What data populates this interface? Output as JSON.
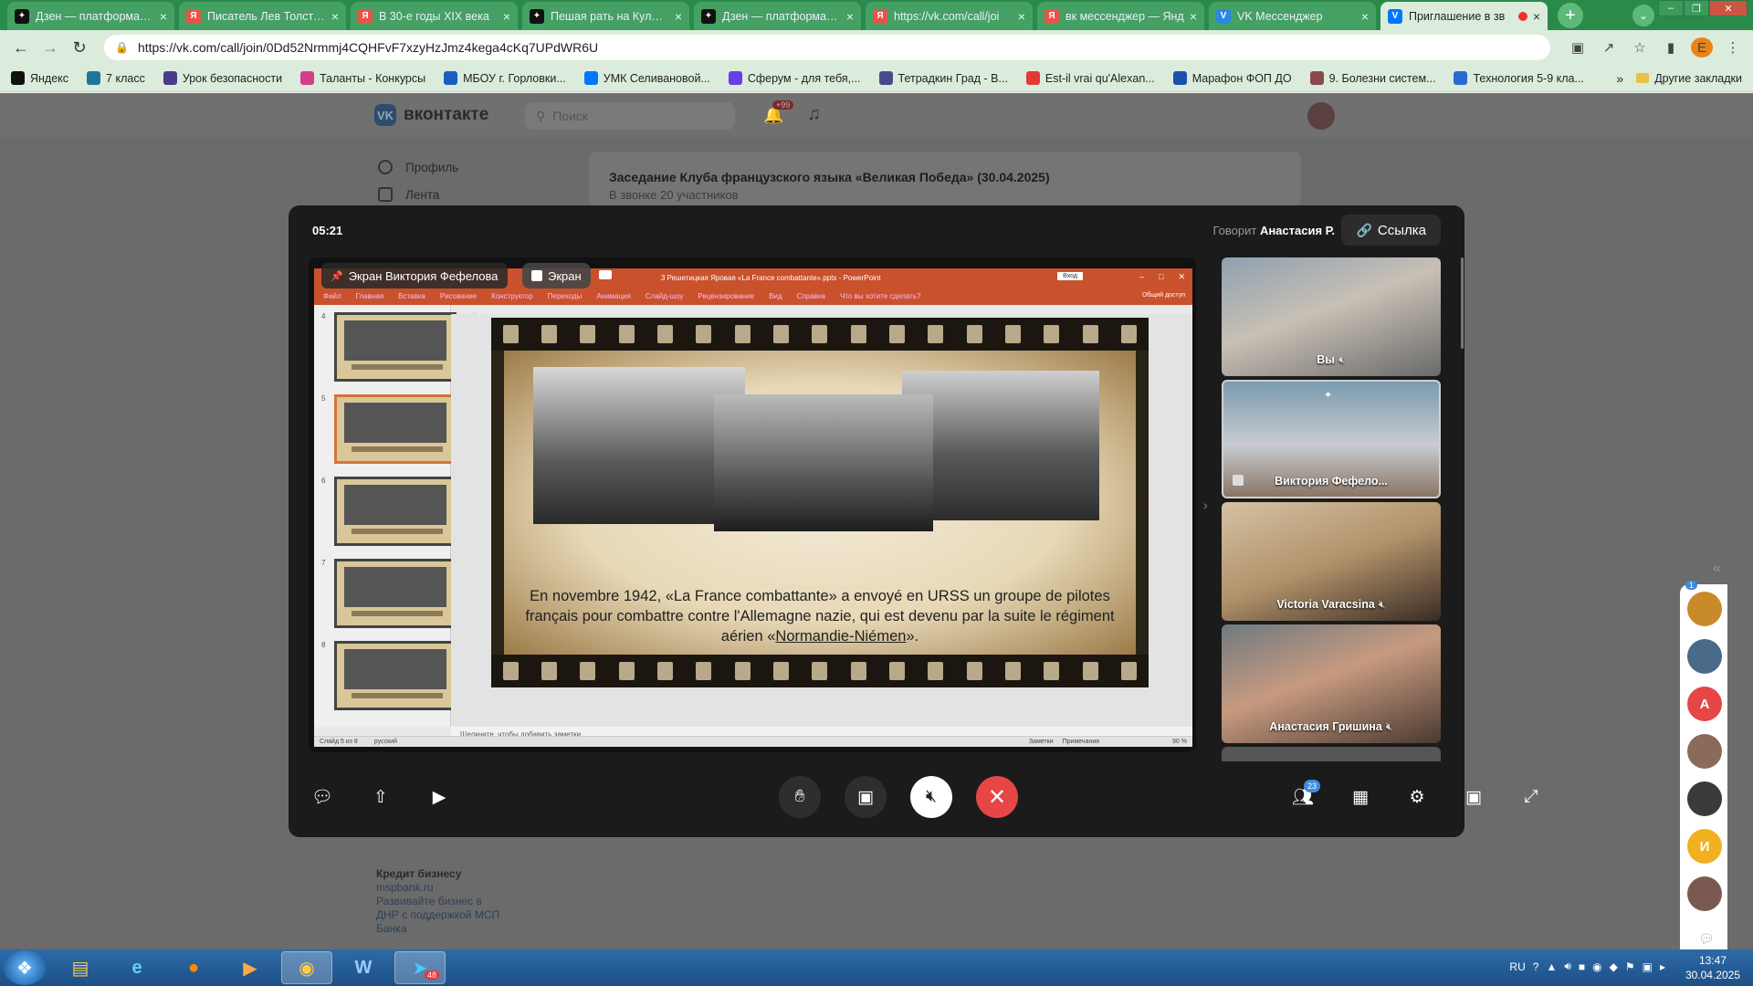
{
  "browser": {
    "tabs": [
      {
        "title": "Дзен — платформа д...",
        "icon": "dzen-icon",
        "color": "#111111"
      },
      {
        "title": "Писатель Лев Толстой",
        "icon": "yandex-icon",
        "color": "#e8534a"
      },
      {
        "title": "В 30-е годы XIX века",
        "icon": "yandex-icon",
        "color": "#e8534a"
      },
      {
        "title": "Пешая рать на Кулико",
        "icon": "dzen-icon",
        "color": "#111111"
      },
      {
        "title": "Дзен — платформа д...",
        "icon": "dzen-icon",
        "color": "#111111"
      },
      {
        "title": "https://vk.com/call/joi",
        "icon": "yandex-icon",
        "color": "#e8534a"
      },
      {
        "title": "вк мессенджер — Янд",
        "icon": "yandex-icon",
        "color": "#e8534a"
      },
      {
        "title": "VK Мессенджер",
        "icon": "vk-messenger-icon",
        "color": "#2b87e6"
      },
      {
        "title": "Приглашение в зв",
        "icon": "vk-icon",
        "color": "#0077ff"
      }
    ],
    "url": "https://vk.com/call/join/0Dd52Nrmmj4CQHFvF7xzyHzJmz4kega4cKq7UPdWR6U",
    "profile_letter": "E",
    "bookmarks": [
      {
        "label": "Яндекс",
        "color": "#111111"
      },
      {
        "label": "7 класс",
        "color": "#21759b"
      },
      {
        "label": "Урок безопасности",
        "color": "#4a3a8a"
      },
      {
        "label": "Таланты - Конкурсы",
        "color": "#d33d8a"
      },
      {
        "label": "МБОУ г. Горловки...",
        "color": "#1a5fc0"
      },
      {
        "label": "УМК Селивановой...",
        "color": "#0077ff"
      },
      {
        "label": "Сферум - для тебя,...",
        "color": "#6a3de8"
      },
      {
        "label": "Тетрадкин Град - В...",
        "color": "#4a4a8a"
      },
      {
        "label": "Est-il vrai qu'Alexan...",
        "color": "#e23a3a"
      },
      {
        "label": "Марафон ФОП ДО",
        "color": "#1c4fb0"
      },
      {
        "label": "9. Болезни систем...",
        "color": "#8a4a4a"
      },
      {
        "label": "Технология 5-9 кла...",
        "color": "#2a6ad0"
      }
    ],
    "other_bookmarks": "Другие закладки"
  },
  "vk": {
    "logo": "вконтакте",
    "search_placeholder": "Поиск",
    "notif_badge": "+99",
    "menu": [
      "Профиль",
      "Лента"
    ],
    "card_title": "Заседание Клуба французского языка «Великая Победа» (30.04.2025)",
    "card_sub": "В звонке 20 участников",
    "ad": {
      "title": "Кредит бизнесу",
      "site": "mspbank.ru",
      "text": "Развивайте бизнес в ДНР с поддержкой МСП Банка"
    }
  },
  "call": {
    "timer": "05:21",
    "speaking_prefix": "Говорит",
    "speaking_name": "Анастасия Р.",
    "link_label": "Ссылка",
    "share_label": "Экран Виктория Фефелова",
    "screen_pill": "Экран",
    "ppt": {
      "filename": "3 Решетицкая Яровая «La France combattante».pptx - PowerPoint",
      "login": "Вход",
      "ribbon": [
        "Файл",
        "Главная",
        "Вставка",
        "Рисование",
        "Конструктор",
        "Переходы",
        "Анимация",
        "Слайд-шоу",
        "Рецензирование",
        "Вид",
        "Справка",
        "Что вы хотите сделать?"
      ],
      "share": "Общий доступ",
      "slide_numbers": [
        "4",
        "5",
        "6",
        "7",
        "8"
      ],
      "notes": "Щелкните, чтобы добавить заметки",
      "status_left": "Слайд 5 из 8",
      "status_lang": "русский",
      "status_notes": "Заметки",
      "status_comments": "Примечания",
      "zoom": "90 %",
      "slide_text_1": "En novembre 1942, «La France combattante» a envoyé en URSS un groupe de pilotes français pour combattre contre l'Allemagne nazie, qui est devenu par la suite le régiment aérien «",
      "slide_text_link": "Normandie-Niémen",
      "slide_text_2": "»."
    },
    "participants": [
      {
        "name": "Вы"
      },
      {
        "name": "Виктория Фефело..."
      },
      {
        "name": "Victoria Varacsina"
      },
      {
        "name": "Анастасия Гришина"
      }
    ],
    "participants_badge": "23"
  },
  "rail": {
    "badge": "1",
    "avatars": [
      {
        "letter": "",
        "color": "#c98a2a"
      },
      {
        "letter": "",
        "color": "#4a6a8a"
      },
      {
        "letter": "А",
        "color": "#e64646"
      },
      {
        "letter": "",
        "color": "#8a6a5a"
      },
      {
        "letter": "",
        "color": "#3a3a3a"
      },
      {
        "letter": "И",
        "color": "#f0b020"
      },
      {
        "letter": "",
        "color": "#7a5a50"
      }
    ]
  },
  "taskbar": {
    "lang": "RU",
    "time": "13:47",
    "date": "30.04.2025",
    "telegram_badge": "48"
  }
}
